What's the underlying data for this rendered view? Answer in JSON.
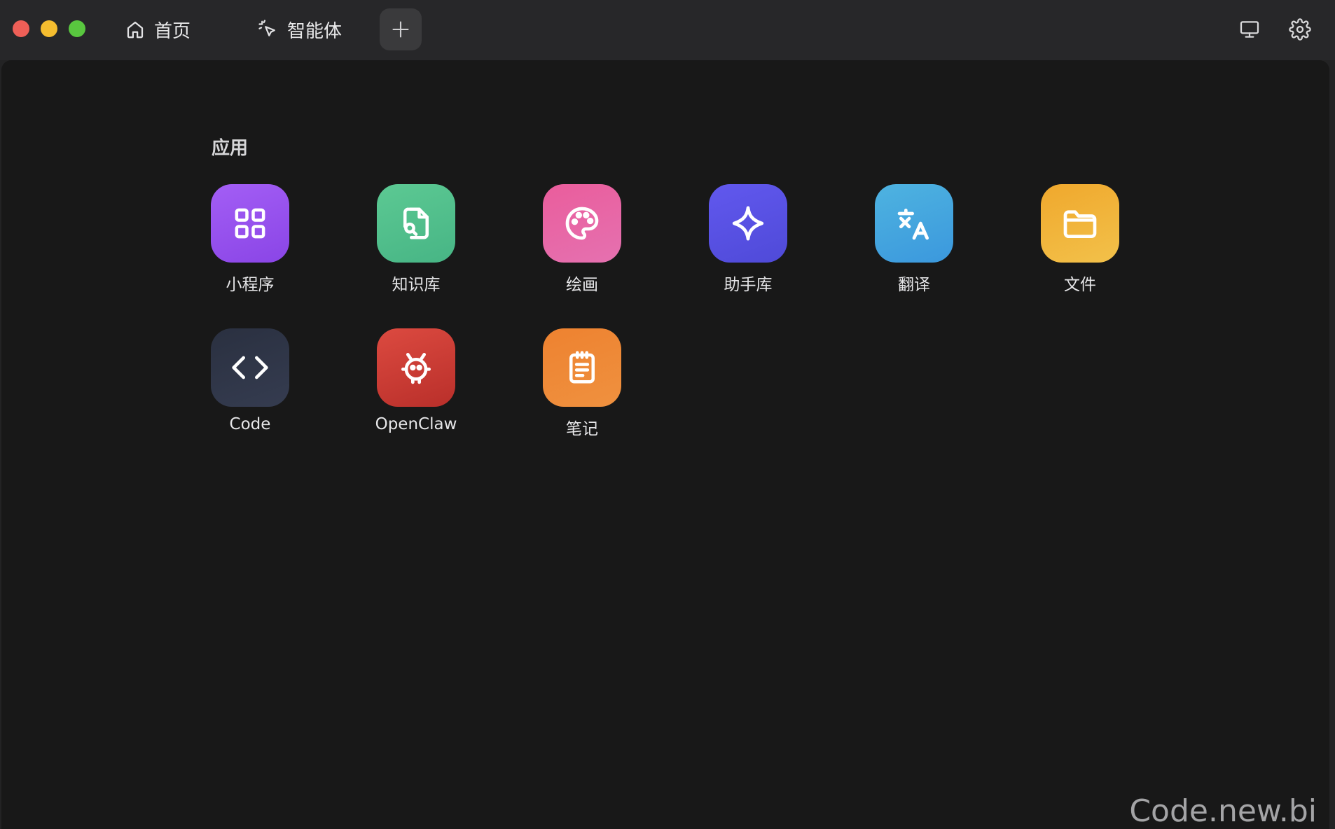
{
  "titlebar": {
    "tabs": [
      {
        "label": "首页",
        "icon": "home-icon"
      },
      {
        "label": "智能体",
        "icon": "sparkle-cursor-icon"
      }
    ],
    "add_tab_icon": "plus-icon",
    "right_icons": [
      "monitor-icon",
      "gear-icon"
    ]
  },
  "apps_section": {
    "title": "应用",
    "apps": [
      {
        "label": "小程序",
        "icon": "grid-icon",
        "color": "#9a55f0"
      },
      {
        "label": "知识库",
        "icon": "document-search-icon",
        "color": "#4fbf8b"
      },
      {
        "label": "绘画",
        "icon": "palette-icon",
        "color": "#e65a9e"
      },
      {
        "label": "助手库",
        "icon": "sparkle-icon",
        "color": "#5a55e6"
      },
      {
        "label": "翻译",
        "icon": "translate-icon",
        "color": "#3ea6df"
      },
      {
        "label": "文件",
        "icon": "folder-icon",
        "color": "#f2ad30"
      },
      {
        "label": "Code",
        "icon": "code-icon",
        "color": "#2d3344"
      },
      {
        "label": "OpenClaw",
        "icon": "claw-bot-icon",
        "color": "#cc3a33"
      },
      {
        "label": "笔记",
        "icon": "notepad-icon",
        "color": "#ee8636"
      }
    ]
  },
  "watermark": "Code.new.bi"
}
